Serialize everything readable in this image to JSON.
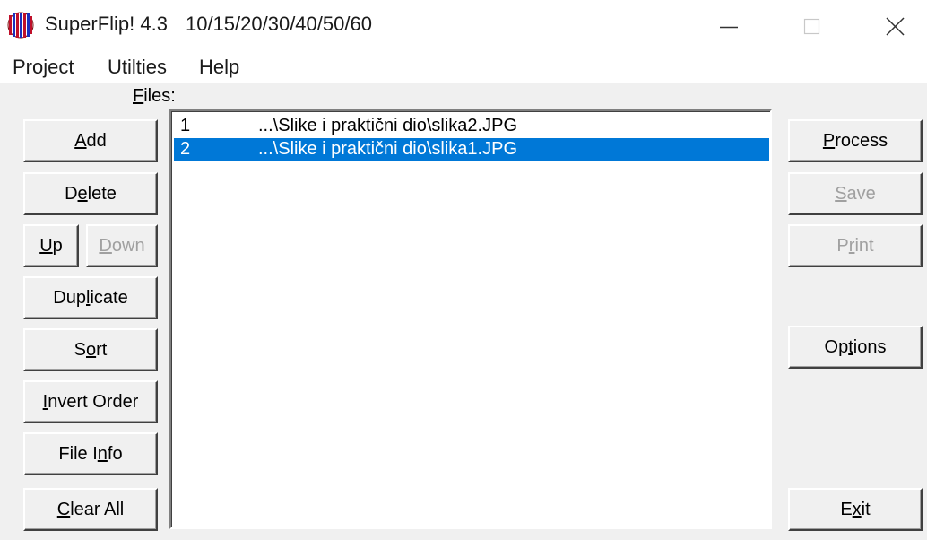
{
  "window": {
    "title": "SuperFlip! 4.3",
    "subtitle": "10/15/20/30/40/50/60"
  },
  "menu": [
    "Project",
    "Utilties",
    "Help"
  ],
  "files_label": {
    "accel": "F",
    "rest": "iles:"
  },
  "left_buttons": [
    {
      "pre": "",
      "accel": "A",
      "post": "dd",
      "enabled": true
    },
    {
      "pre": "D",
      "accel": "e",
      "post": "lete",
      "enabled": true
    },
    {
      "pre": "",
      "accel": "U",
      "post": "p",
      "enabled": true
    },
    {
      "pre": "",
      "accel": "D",
      "post": "own",
      "enabled": false
    },
    {
      "pre": "Dup",
      "accel": "l",
      "post": "icate",
      "enabled": true
    },
    {
      "pre": "S",
      "accel": "o",
      "post": "rt",
      "enabled": true
    },
    {
      "pre": "",
      "accel": "I",
      "post": "nvert Order",
      "enabled": true
    },
    {
      "pre": "File I",
      "accel": "n",
      "post": "fo",
      "enabled": true
    },
    {
      "pre": "",
      "accel": "C",
      "post": "lear All",
      "enabled": true
    }
  ],
  "right_buttons": [
    {
      "pre": "",
      "accel": "P",
      "post": "rocess",
      "enabled": true
    },
    {
      "pre": "",
      "accel": "S",
      "post": "ave",
      "enabled": false
    },
    {
      "pre": "P",
      "accel": "r",
      "post": "int",
      "enabled": false
    },
    {
      "pre": "Op",
      "accel": "t",
      "post": "ions",
      "enabled": true
    },
    {
      "pre": "E",
      "accel": "x",
      "post": "it",
      "enabled": true
    }
  ],
  "files": [
    {
      "num": "1",
      "path": "...\\Slike i praktični dio\\slika2.JPG",
      "selected": false
    },
    {
      "num": "2",
      "path": "...\\Slike i praktični dio\\slika1.JPG",
      "selected": true
    }
  ],
  "colors": {
    "selection": "#0078d7",
    "disabled_text": "#a0a0a0"
  },
  "icons": {
    "app": "superflip-app-icon",
    "minimize": "minimize-icon",
    "maximize": "maximize-icon",
    "close": "close-icon"
  }
}
